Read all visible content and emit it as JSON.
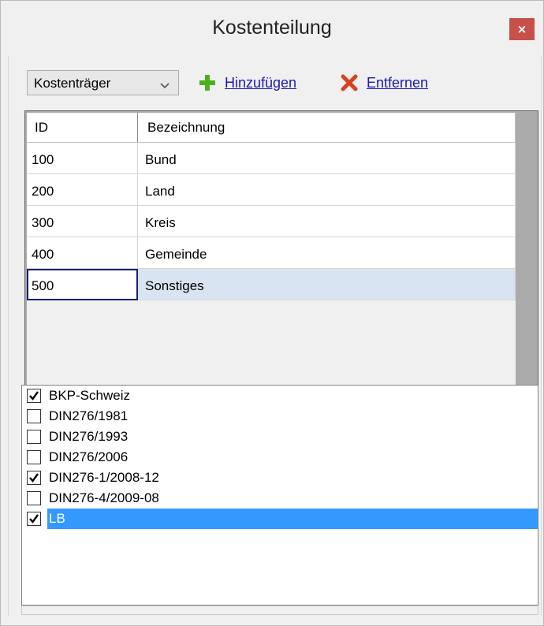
{
  "window": {
    "title": "Kostenteilung",
    "close_label": "×"
  },
  "toolbar": {
    "dropdown_value": "Kostenträger",
    "add_label": "Hinzufügen",
    "remove_label": "Entfernen"
  },
  "grid": {
    "headers": {
      "id": "ID",
      "name": "Bezeichnung"
    },
    "rows": [
      {
        "id": "100",
        "name": "Bund"
      },
      {
        "id": "200",
        "name": "Land"
      },
      {
        "id": "300",
        "name": "Kreis"
      },
      {
        "id": "400",
        "name": "Gemeinde"
      },
      {
        "id": "500",
        "name": "Sonstiges"
      }
    ],
    "selected_index": 4
  },
  "checklist": {
    "items": [
      {
        "label": "BKP-Schweiz",
        "checked": true
      },
      {
        "label": "DIN276/1981",
        "checked": false
      },
      {
        "label": "DIN276/1993",
        "checked": false
      },
      {
        "label": "DIN276/2006",
        "checked": false
      },
      {
        "label": "DIN276-1/2008-12",
        "checked": true
      },
      {
        "label": "DIN276-4/2009-08",
        "checked": false
      },
      {
        "label": "LB",
        "checked": true
      }
    ],
    "selected_index": 6
  },
  "colors": {
    "close_button": "#c7504a",
    "link": "#1a1ab5",
    "selected_row": "#d8e4f1",
    "selected_list_item": "#3399ff",
    "add_icon": "#4caf1f",
    "remove_icon": "#d9411e"
  },
  "icons": {
    "add": "plus-icon",
    "remove": "x-icon",
    "dropdown": "chevron-down-icon",
    "check": "checkmark-icon"
  }
}
